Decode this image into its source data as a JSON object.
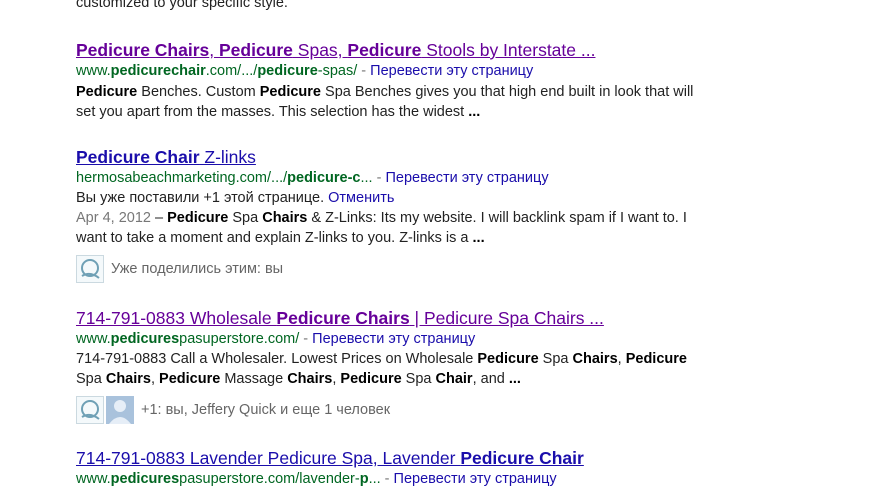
{
  "top_snippet": "customized to your specific style.",
  "translate_label": "Перевести эту страницу",
  "results": [
    {
      "title_parts": [
        "Pedicure Chairs",
        ", ",
        "Pedicure",
        " Spas, ",
        "Pedicure",
        " Stools by Interstate ..."
      ],
      "url_parts": [
        "www.",
        "pedicurechair",
        ".com/.../",
        "pedicure",
        "-spas/"
      ],
      "separator": " - ",
      "snippet_parts": [
        "Pedicure",
        " Benches. Custom ",
        "Pedicure",
        " Spa Benches gives you that high end built in look that will set you apart from the masses. This selection has the widest ",
        "..."
      ]
    },
    {
      "title_parts": [
        "Pedicure Chair",
        " Z-links"
      ],
      "url_parts": [
        "hermosabeachmarketing.com/.../",
        "pedicure-c",
        "..."
      ],
      "separator": " - ",
      "plusone_text": "Вы уже поставили +1 этой странице.",
      "plusone_undo": "Отменить",
      "date": "Apr 4, 2012",
      "date_sep": " – ",
      "snippet_parts": [
        "Pedicure",
        " Spa ",
        "Chairs",
        " & Z-Links: Its my website. I will backlink spam if I want to. I want to take a moment and explain Z-links to you. Z-links is a ",
        "..."
      ],
      "social_text": "Уже поделились этим: вы"
    },
    {
      "title_parts": [
        "714-791-0883 Wholesale ",
        "Pedicure Chairs",
        " | Pedicure Spa Chairs ..."
      ],
      "url_parts": [
        "www.",
        "pedicures",
        "pasuperstore.com/"
      ],
      "separator": " - ",
      "snippet_parts": [
        "714-791-0883 Call a Wholesaler. Lowest Prices on Wholesale ",
        "Pedicure",
        " Spa ",
        "Chairs",
        ", ",
        "Pedicure",
        " Spa ",
        "Chairs",
        ", ",
        "Pedicure",
        " Massage ",
        "Chairs",
        ", ",
        "Pedicure",
        " Spa ",
        "Chair",
        ", and ",
        "..."
      ],
      "social_text": "+1: вы, Jeffery Quick и еще 1 человек"
    },
    {
      "title_parts": [
        "714-791-0883 Lavender Pedicure Spa, Lavender ",
        "Pedicure Chair"
      ],
      "url_parts": [
        "www.",
        "pedicures",
        "pasuperstore.com/lavender-",
        "p",
        "..."
      ],
      "separator": " - "
    }
  ],
  "colors": {
    "link_visited": "#660099",
    "link_unvisited": "#1a0dab",
    "url_green": "#006621",
    "date_gray": "#777777"
  },
  "icons": [
    "site-logo-icon",
    "user-avatar-icon"
  ]
}
